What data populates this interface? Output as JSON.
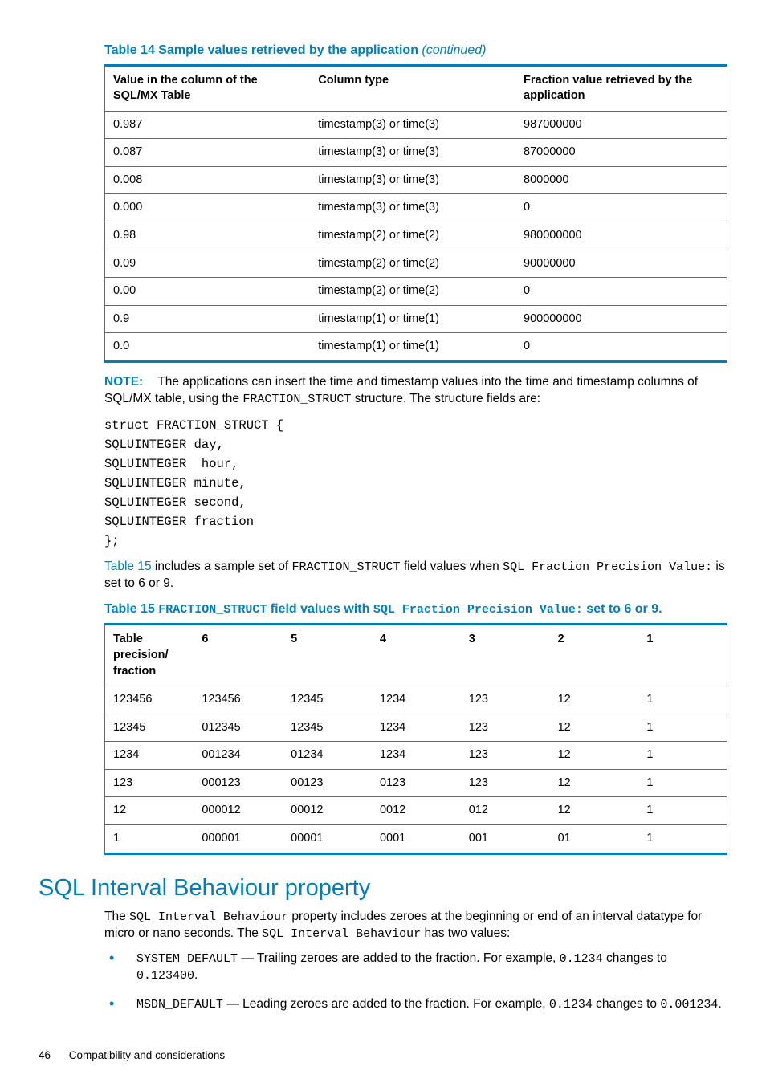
{
  "table14": {
    "caption_prefix": "Table 14 Sample values retrieved by the application ",
    "caption_cont": "(continued)",
    "headers": {
      "c1": "Value in the column of the SQL/MX Table",
      "c2": "Column type",
      "c3": "Fraction value retrieved by the application"
    },
    "rows": [
      {
        "c1": "0.987",
        "c2": "timestamp(3) or time(3)",
        "c3": "987000000"
      },
      {
        "c1": "0.087",
        "c2": "timestamp(3) or time(3)",
        "c3": "87000000"
      },
      {
        "c1": "0.008",
        "c2": "timestamp(3) or time(3)",
        "c3": "8000000"
      },
      {
        "c1": "0.000",
        "c2": "timestamp(3) or time(3)",
        "c3": "0"
      },
      {
        "c1": "0.98",
        "c2": "timestamp(2) or time(2)",
        "c3": "980000000"
      },
      {
        "c1": "0.09",
        "c2": "timestamp(2) or time(2)",
        "c3": "90000000"
      },
      {
        "c1": "0.00",
        "c2": "timestamp(2) or time(2)",
        "c3": "0"
      },
      {
        "c1": "0.9",
        "c2": "timestamp(1) or time(1)",
        "c3": "900000000"
      },
      {
        "c1": "0.0",
        "c2": "timestamp(1) or time(1)",
        "c3": "0"
      }
    ]
  },
  "note": {
    "label": "NOTE:",
    "text_before_mono": "The applications can insert the time and timestamp values into the time and timestamp columns of SQL/MX table, using the ",
    "mono": "FRACTION_STRUCT",
    "text_after_mono": " structure. The structure fields are:"
  },
  "code": "struct FRACTION_STRUCT {\nSQLUINTEGER day,\nSQLUINTEGER  hour,\nSQLUINTEGER minute,\nSQLUINTEGER second,\nSQLUINTEGER fraction\n};",
  "para15": {
    "link": "Table 15",
    "a": " includes a sample set of ",
    "m1": "FRACTION_STRUCT",
    "b": " field values when ",
    "m2": "SQL Fraction Precision Value:",
    "c": " is set to 6 or 9."
  },
  "table15": {
    "caption_a": "Table 15 ",
    "caption_m1": "FRACTION_STRUCT",
    "caption_b": " field values with ",
    "caption_m2": "SQL Fraction Precision Value:",
    "caption_c": " set to 6 or 9.",
    "headers": {
      "h0": "Table precision/ fraction",
      "h1": "6",
      "h2": "5",
      "h3": "4",
      "h4": "3",
      "h5": "2",
      "h6": "1"
    },
    "rows": [
      {
        "c0": "123456",
        "c1": "123456",
        "c2": "12345",
        "c3": "1234",
        "c4": "123",
        "c5": "12",
        "c6": "1"
      },
      {
        "c0": "12345",
        "c1": "012345",
        "c2": "12345",
        "c3": "1234",
        "c4": "123",
        "c5": "12",
        "c6": "1"
      },
      {
        "c0": "1234",
        "c1": "001234",
        "c2": "01234",
        "c3": "1234",
        "c4": "123",
        "c5": "12",
        "c6": "1"
      },
      {
        "c0": "123",
        "c1": "000123",
        "c2": "00123",
        "c3": "0123",
        "c4": "123",
        "c5": "12",
        "c6": "1"
      },
      {
        "c0": "12",
        "c1": "000012",
        "c2": "00012",
        "c3": "0012",
        "c4": "012",
        "c5": "12",
        "c6": "1"
      },
      {
        "c0": "1",
        "c1": "000001",
        "c2": "00001",
        "c3": "0001",
        "c4": "001",
        "c5": "01",
        "c6": "1"
      }
    ]
  },
  "section": {
    "heading": "SQL Interval Behaviour property",
    "p_a": "The ",
    "p_m1": "SQL Interval Behaviour",
    "p_b": " property includes zeroes at the beginning or end of an interval datatype for micro or nano seconds. The ",
    "p_m2": "SQL Interval Behaviour",
    "p_c": " has two values:",
    "b1_m1": "SYSTEM_DEFAULT",
    "b1_a": " — Trailing zeroes are added to the fraction. For example, ",
    "b1_m2": "0.1234",
    "b1_b": " changes to ",
    "b1_m3": "0.123400",
    "b1_c": ".",
    "b2_m1": "MSDN_DEFAULT",
    "b2_a": " — Leading zeroes are added to the fraction. For example, ",
    "b2_m2": "0.1234",
    "b2_b": " changes to ",
    "b2_m3": "0.001234",
    "b2_c": "."
  },
  "footer": {
    "page": "46",
    "title": "Compatibility and considerations"
  }
}
